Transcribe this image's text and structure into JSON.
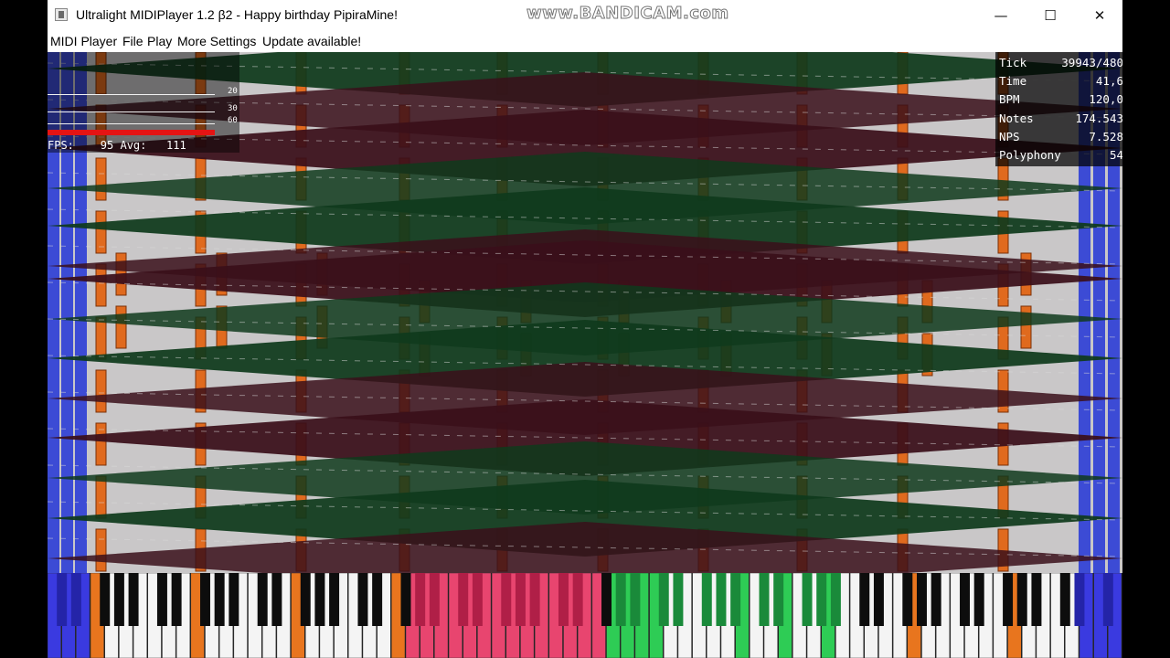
{
  "window": {
    "title": "Ultralight MIDIPlayer 1.2 β2 - Happy birthday PipiraMine!",
    "minimize_glyph": "—",
    "maximize_glyph": "☐",
    "close_glyph": "✕"
  },
  "menu": {
    "items": [
      "MIDI Player",
      "File",
      "Play",
      "More Settings",
      "Update available!"
    ]
  },
  "watermark": "www.BANDICAM.com",
  "stats": {
    "graph_labels": [
      "20",
      "30",
      "60"
    ],
    "fps_line": "FPS:    95 Avg:   111"
  },
  "info": {
    "rows": [
      {
        "label": "Tick",
        "value": "39943/480"
      },
      {
        "label": "Time",
        "value": "41,6"
      },
      {
        "label": "BPM",
        "value": "120,0"
      },
      {
        "label": "Notes",
        "value": "174.543"
      },
      {
        "label": "NPS",
        "value": "7.528"
      },
      {
        "label": "Polyphony",
        "value": "54"
      }
    ]
  },
  "colors": {
    "background": "#c9c7c8",
    "note_orange": "#e06a1e",
    "note_dark_red": "#3a0f1a",
    "note_dark_green": "#0f3a1c",
    "note_blue": "#2c3dd6",
    "key_pink": "#e8456f",
    "key_green": "#2ecc55",
    "key_orange": "#e8751e",
    "key_blue": "#3a3ae0"
  }
}
